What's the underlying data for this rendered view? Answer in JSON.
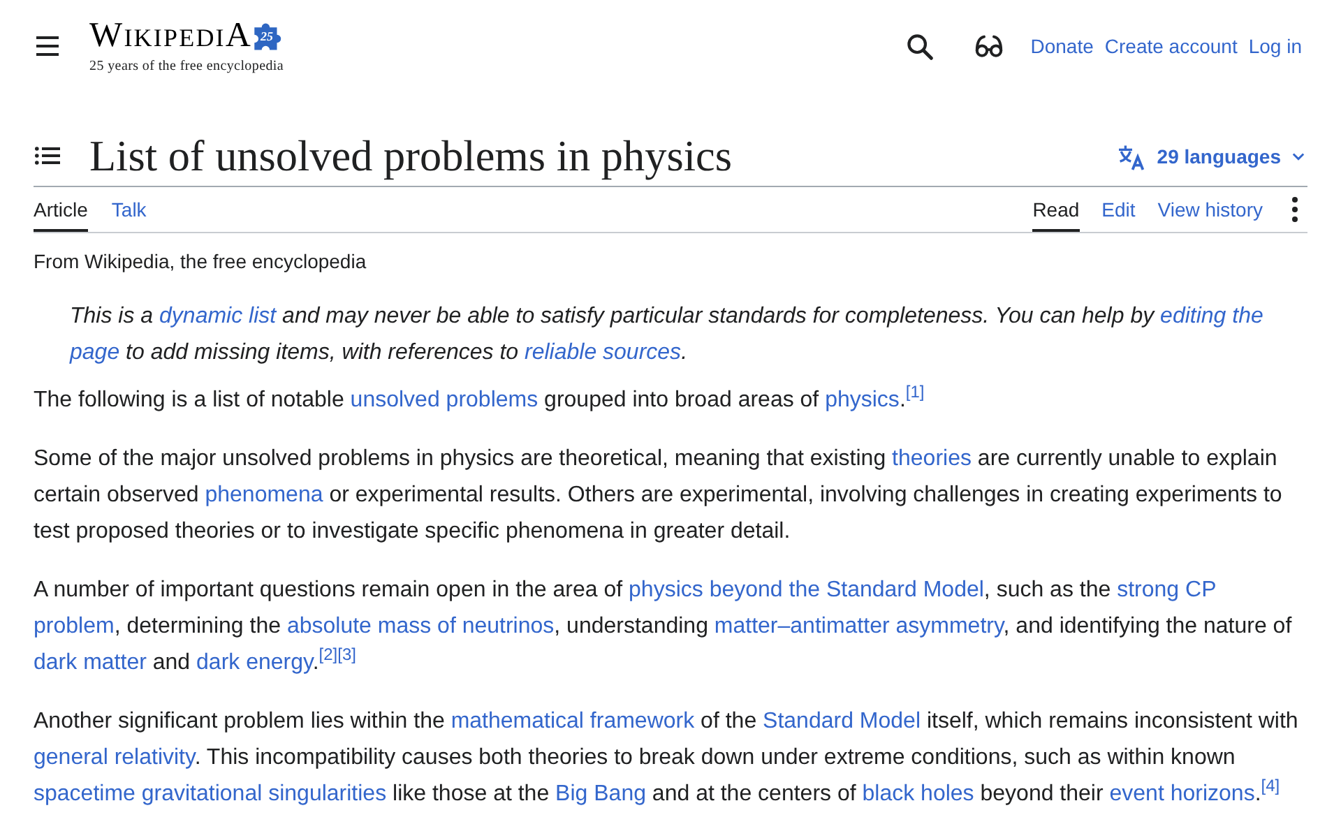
{
  "header": {
    "logo": {
      "wordmark": "WikipediA",
      "badge": "25",
      "tagline": "25 years of the free encyclopedia"
    },
    "links": [
      "Donate",
      "Create account",
      "Log in"
    ]
  },
  "page_title": "List of unsolved problems in physics",
  "languages": {
    "label": "29 languages"
  },
  "namespace_tabs": [
    {
      "label": "Article",
      "selected": true
    },
    {
      "label": "Talk",
      "selected": false
    }
  ],
  "view_tabs": [
    {
      "label": "Read",
      "selected": true
    },
    {
      "label": "Edit",
      "selected": false
    },
    {
      "label": "View history",
      "selected": false
    }
  ],
  "site_sub": "From Wikipedia, the free encyclopedia",
  "notice": {
    "segments": [
      {
        "kind": "text",
        "text": "This is a "
      },
      {
        "kind": "link",
        "text": "dynamic list"
      },
      {
        "kind": "text",
        "text": " and may never be able to satisfy particular standards for completeness. You can help by "
      },
      {
        "kind": "link",
        "text": "editing the"
      },
      {
        "kind": "link",
        "text": "page"
      },
      {
        "kind": "text",
        "text": " to add missing items, with references to "
      },
      {
        "kind": "link",
        "text": "reliable sources"
      },
      {
        "kind": "text",
        "text": "."
      }
    ]
  },
  "paragraphs": [
    {
      "segments": [
        {
          "kind": "text",
          "text": "The following is a list of notable "
        },
        {
          "kind": "link",
          "text": "unsolved problems"
        },
        {
          "kind": "text",
          "text": " grouped into broad areas of "
        },
        {
          "kind": "link",
          "text": "physics"
        },
        {
          "kind": "text",
          "text": ".",
          "refs": [
            "[1]"
          ]
        }
      ]
    },
    {
      "segments": [
        {
          "kind": "text",
          "text": "Some of the major unsolved problems in physics are theoretical, meaning that existing "
        },
        {
          "kind": "link",
          "text": "theories"
        },
        {
          "kind": "text",
          "text": " are currently unable to explain certain observed "
        },
        {
          "kind": "link",
          "text": "phenomena"
        },
        {
          "kind": "text",
          "text": " or experimental results. Others are experimental, involving challenges in creating experiments to test proposed theories or to investigate specific phenomena in greater detail."
        }
      ]
    },
    {
      "segments": [
        {
          "kind": "text",
          "text": "A number of important questions remain open in the area of "
        },
        {
          "kind": "link",
          "text": "physics beyond the Standard Model"
        },
        {
          "kind": "text",
          "text": ", such as the "
        },
        {
          "kind": "link",
          "text": "strong CP"
        },
        {
          "kind": "link",
          "text": "problem"
        },
        {
          "kind": "text",
          "text": ", determining the "
        },
        {
          "kind": "link",
          "text": "absolute mass of neutrinos"
        },
        {
          "kind": "text",
          "text": ", understanding "
        },
        {
          "kind": "link",
          "text": "matter–antimatter asymmetry"
        },
        {
          "kind": "text",
          "text": ", and identifying the nature of "
        },
        {
          "kind": "link",
          "text": "dark matter"
        },
        {
          "kind": "text",
          "text": " and "
        },
        {
          "kind": "link",
          "text": "dark energy"
        },
        {
          "kind": "text",
          "text": ".",
          "refs": [
            "[2]",
            "[3]"
          ]
        }
      ]
    },
    {
      "segments": [
        {
          "kind": "text",
          "text": "Another significant problem lies within the "
        },
        {
          "kind": "link",
          "text": "mathematical framework"
        },
        {
          "kind": "text",
          "text": " of the "
        },
        {
          "kind": "link",
          "text": "Standard Model"
        },
        {
          "kind": "text",
          "text": " itself, which remains inconsistent with "
        },
        {
          "kind": "link",
          "text": "general relativity"
        },
        {
          "kind": "text",
          "text": ". This incompatibility causes both theories to break down under extreme conditions, such as within known "
        },
        {
          "kind": "link",
          "text": "spacetime gravitational singularities"
        },
        {
          "kind": "text",
          "text": " like those at the "
        },
        {
          "kind": "link",
          "text": "Big Bang"
        },
        {
          "kind": "text",
          "text": " and at the centers of "
        },
        {
          "kind": "link",
          "text": "black holes"
        },
        {
          "kind": "text",
          "text": " beyond their "
        },
        {
          "kind": "link",
          "text": "event horizons"
        },
        {
          "kind": "text",
          "text": ".",
          "refs": [
            "[4]"
          ]
        }
      ]
    }
  ]
}
